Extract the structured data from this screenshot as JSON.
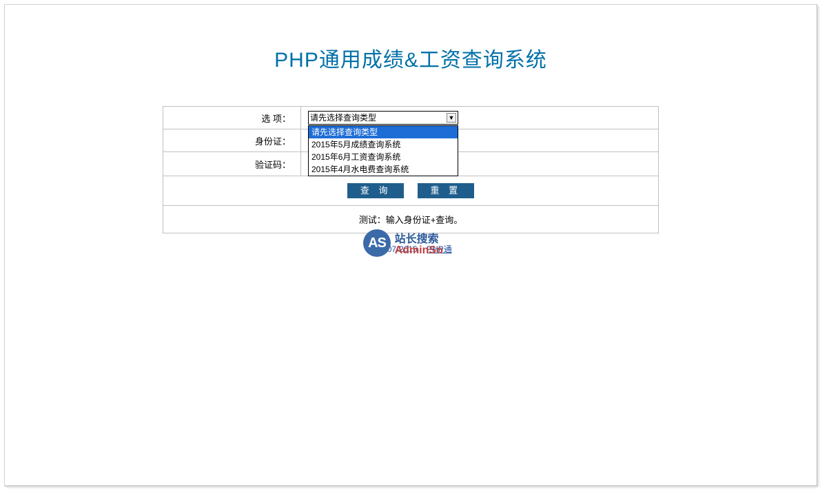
{
  "page": {
    "title": "PHP通用成绩&工资查询系统"
  },
  "form": {
    "option_label": "选  项：",
    "id_label": "身份证：",
    "captcha_label": "验证码：",
    "select_placeholder": "请先选择查询类型",
    "dropdown": {
      "options": [
        "请先选择查询类型",
        "2015年5月成绩查询系统",
        "2015年6月工资查询系统",
        "2015年4月水电费查询系统"
      ]
    },
    "query_button": "查 询",
    "reset_button": "重 置",
    "hint": "测试：输入身份证+查询。"
  },
  "footer": {
    "copyright": "© 2007-2015",
    "link_text": "PHP通"
  },
  "logo": {
    "badge": "AS",
    "cn": "站长搜索",
    "en": "AdminSo"
  }
}
